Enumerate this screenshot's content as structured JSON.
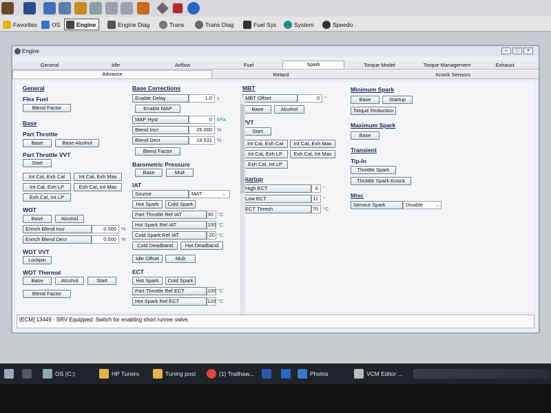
{
  "menu": {
    "favorites": "Favorites",
    "os": "OS",
    "engine": "Engine",
    "engine_diag": "Engine Diag",
    "trans": "Trans",
    "trans_diag": "Trans Diag",
    "fuel_sys": "Fuel Sys",
    "system": "System",
    "speedo": "Speedo"
  },
  "window": {
    "title": "Engine",
    "tabs_row1": [
      "General",
      "Idle",
      "Airflow",
      "Fuel",
      "Spark",
      "Torque Model",
      "Torque Management",
      "Exhaust"
    ],
    "tabs_row2": [
      "Advance",
      "Retard",
      "Knock Sensors"
    ]
  },
  "col1": {
    "general": "General",
    "flex_fuel": "Flex Fuel",
    "blend_factor": "Blend Factor",
    "base_header": "Base",
    "part_throttle": "Part Throttle",
    "pt_base": "Base",
    "pt_base_alcohol": "Base Alcohol",
    "part_throttle_vvt": "Part Throttle VVT",
    "vvt_start": "Start",
    "int_cal_exh_cal": "Int Cal, Exh Cal",
    "int_cal_exh_max": "Int Cal, Exh Max",
    "int_cal_exh_lp": "Int Cal, Exh LP",
    "exh_cal_int_max": "Exh Cal, Int Max",
    "exh_cal_int_lp": "Exh Cal, Int LP",
    "wot": "WOT",
    "wot_base": "Base",
    "wot_alcohol": "Alcohol",
    "enrich_incr_label": "Enrich Blend Incr",
    "enrich_incr_value": "0.000",
    "enrich_decr_label": "Enrich Blend Decr",
    "enrich_decr_value": "0.000",
    "pct": "%",
    "wot_vvt": "WOT VVT",
    "lockpin": "Lockpin",
    "wot_thermal": "WOT Thermal",
    "wt_base": "Base",
    "wt_alcohol": "Alcohol",
    "wt_start": "Start",
    "wt_blend": "Blend Factor"
  },
  "col2": {
    "base_corrections": "Base Corrections",
    "enable_delay_label": "Enable Delay",
    "enable_delay_value": "1.0",
    "enable_delay_unit": "s",
    "enable_map": "Enable MAP",
    "map_hyst_label": "MAP Hyst",
    "map_hyst_value": "0",
    "map_hyst_unit": "kPa",
    "blend_incr_label": "Blend Incr",
    "blend_incr_value": "25.000",
    "blend_decr_label": "Blend Decr",
    "blend_decr_value": "19.531",
    "pct": "%",
    "blend_factor": "Blend Factor",
    "baro": "Barometric Pressure",
    "baro_base": "Base",
    "baro_mult": "Mult",
    "iat": "IAT",
    "source_label": "Source",
    "source_value": "MAT",
    "hot_spark": "Hot Spark",
    "cold_spark": "Cold Spark",
    "pt_ref_iat_label": "Part Throttle Ref IAT",
    "pt_ref_iat_value": "30",
    "hs_ref_iat_label": "Hot Spark Ref IAT",
    "hs_ref_iat_value": "100",
    "cs_ref_iat_label": "Cold Spark Ref IAT",
    "cs_ref_iat_value": "-20",
    "degc": "°C",
    "cold_deadband": "Cold Deadband",
    "hot_deadband": "Hot Deadband",
    "idle_offset": "Idle Offset",
    "mult": "Mult",
    "ect": "ECT",
    "ect_hot_spark": "Hot Spark",
    "ect_cold_spark": "Cold Spark",
    "pt_ref_ect_label": "Part Throttle Ref ECT",
    "pt_ref_ect_value": "100",
    "hs_ref_ect_label": "Hot Spark Ref ECT",
    "hs_ref_ect_value": "120"
  },
  "col3": {
    "mbt": "MBT",
    "mbt_offset_label": "MBT Offset",
    "mbt_offset_value": "0",
    "deg": "°",
    "mbt_base": "Base",
    "mbt_alcohol": "Alcohol",
    "vvt": "VVT",
    "vvt_start": "Start",
    "int_cal_exh_cal": "Int Cal, Exh Cal",
    "int_cal_exh_max": "Int Cal, Exh Max",
    "int_cal_exh_lp": "Int Cal, Exh LP",
    "exh_cal_int_max": "Exh Cal, Int Max",
    "exh_cal_int_lp": "Exh Cal, Int LP",
    "startup": "Startup",
    "high_ect_label": "High ECT",
    "high_ect_value": "6",
    "low_ect_label": "Low ECT",
    "low_ect_value": "11",
    "ect_thresh_label": "ECT Thresh",
    "ect_thresh_value": "70",
    "degc": "°C"
  },
  "col4": {
    "min_spark": "Minimum Spark",
    "min_base": "Base",
    "min_startup": "Startup",
    "torque_reduction": "Torque Reduction",
    "max_spark": "Maximum Spark",
    "max_base": "Base",
    "transient": "Transient",
    "tip_in": "Tip-In",
    "throttle_spark": "Throttle Spark",
    "throttle_spark_knock": "Throttle Spark Knock",
    "misc": "Misc",
    "service_spark_label": "Service Spark",
    "service_spark_value": "Disable"
  },
  "status": {
    "text": "[ECM] 13449 - SRV Equipped: Switch for enabling short runner valve."
  },
  "taskbar": {
    "os_c": "OS (C:)",
    "hp_tuners": "HP Tuners",
    "tuning_post": "Tuning post",
    "trailhaw": "(1) Trailhaw...",
    "photos": "Photos",
    "vcm_editor": "VCM Editor ..."
  },
  "colors": {
    "header_text": "#15255a",
    "unit_green": "#2a8a4a",
    "taskbar": "#20232a"
  }
}
